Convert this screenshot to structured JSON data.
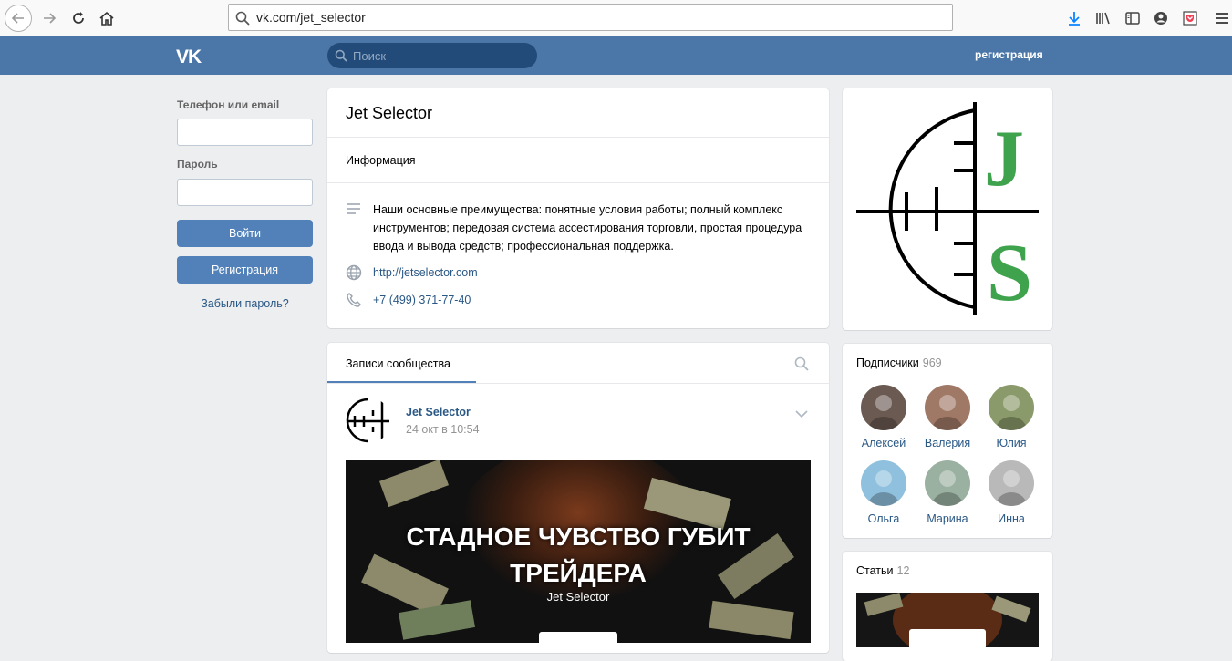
{
  "browser": {
    "url": "vk.com/jet_selector",
    "icons": [
      "back-arrow-icon",
      "forward-arrow-icon",
      "reload-icon",
      "home-icon",
      "search-icon",
      "download-icon",
      "library-icon",
      "sidebar-icon",
      "account-icon",
      "pocket-icon",
      "menu-icon"
    ]
  },
  "header": {
    "logo": "VK",
    "search_placeholder": "Поиск",
    "register_link": "регистрация",
    "color": "#4a76a8"
  },
  "login": {
    "phone_label": "Телефон или email",
    "password_label": "Пароль",
    "login_button": "Войти",
    "register_button": "Регистрация",
    "forgot_link": "Забыли пароль?"
  },
  "info": {
    "title": "Jet Selector",
    "section": "Информация",
    "description": "Наши основные преимущества: понятные условия работы; полный комплекс инструментов; передовая система ассестирования торговли, простая процедура ввода и вывода средств; профессиональная поддержка.",
    "website": "http://jetselector.com",
    "phone": "+7 (499) 371-77-40"
  },
  "wall": {
    "tab": "Записи сообщества",
    "post": {
      "author": "Jet Selector",
      "date": "24 окт в 10:54",
      "image_title": "СТАДНОЕ ЧУВСТВО ГУБИТ ТРЕЙДЕРА",
      "image_subtitle": "Jet Selector"
    }
  },
  "logo_letters": {
    "top": "J",
    "bottom": "S",
    "color": "#3fa34d"
  },
  "subscribers": {
    "label": "Подписчики",
    "count": "969",
    "people": [
      {
        "name": "Алексей",
        "color": "#6b5a52"
      },
      {
        "name": "Валерия",
        "color": "#a07866"
      },
      {
        "name": "Юлия",
        "color": "#8a9a6a"
      },
      {
        "name": "Ольга",
        "color": "#8fc0de"
      },
      {
        "name": "Марина",
        "color": "#9ab0a0"
      },
      {
        "name": "Инна",
        "color": "#b9b9b9"
      }
    ]
  },
  "articles": {
    "label": "Статьи",
    "count": "12"
  }
}
